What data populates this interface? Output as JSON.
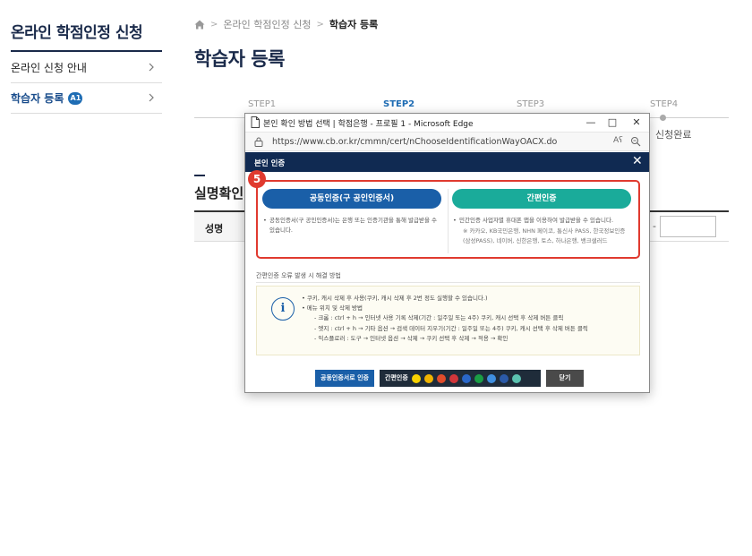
{
  "sidebar": {
    "title": "온라인 학점인정 신청",
    "items": [
      {
        "label": "온라인 신청 안내",
        "badge": ""
      },
      {
        "label": "학습자 등록",
        "badge": "A1"
      }
    ]
  },
  "breadcrumb": {
    "items": [
      "온라인 학점인정 신청",
      "학습자 등록"
    ]
  },
  "page": {
    "title": "학습자 등록",
    "steps": [
      "STEP1",
      "STEP2",
      "STEP3",
      "STEP4"
    ],
    "active_step": "STEP2",
    "step4_status": "신청완료",
    "section_title": "실명확인",
    "form_label": "성명",
    "form_dash": "-"
  },
  "popup": {
    "window_title": "본인 확인 방법 선택 | 학점은행 - 프로필 1 - Microsoft Edge",
    "url": "https://www.cb.or.kr/cmmn/cert/nChooseIdentificationWayOACX.do",
    "read_aloud": "Aʕ",
    "dialog_title": "본인 인증",
    "callout_number": "5",
    "cert_button": "공동인증(구 공인인증서)",
    "cert_desc": "공동인증서(구 공인인증서)는 은행 또는 인증기관을 통해 발급받을 수 있습니다.",
    "simple_button": "간편인증",
    "simple_desc": "민간인증 사업자별 휴대폰 앱을 이용하여 발급받을 수 있습니다.",
    "simple_note": "※ 카카오, KB국민은행, NHN 페이코, 통신사 PASS, 한국정보인증(삼성PASS), 네이버, 신한은행, 토스, 하나은행, 뱅크샐러드",
    "error_heading": "간편인증 오류 발생 시 해결 방법",
    "info_lines": [
      "쿠키, 캐시 삭제 후 사용(쿠키, 캐시 삭제 후 2번 정도 실행할 수 있습니다.)",
      "메뉴 위치 및 삭제 방법",
      "- 크롬 : ctrl + h → 인터넷 사용 기록 삭제(기간 : 일주일 또는 4주) 쿠키, 캐시 선택 후 삭제 버튼 클릭",
      "- 엣지 : ctrl + h → 기타 옵션 → 검색 데이터 지우기(기간 : 일주일 또는 4주) 쿠키, 캐시 선택 후 삭제 버튼 클릭",
      "- 익스플로러 : 도구 → 인터넷 옵션 → 삭제 → 쿠키 선택 후 삭제 → 적용 → 확인"
    ],
    "btn_cert_login": "공동인증서로 인증",
    "btn_simple_login": "간편인증",
    "btn_close": "닫기",
    "provider_colors": [
      "#f7d200",
      "#f0b400",
      "#e04c2b",
      "#d1363b",
      "#2a67c9",
      "#1a9e45",
      "#3f8fe0",
      "#2b5aa8",
      "#5bc2b0"
    ]
  },
  "colors": {
    "navy": "#102a52",
    "accent_blue": "#1a5fa8",
    "teal": "#1aab9a",
    "callout_red": "#e03a2f"
  }
}
